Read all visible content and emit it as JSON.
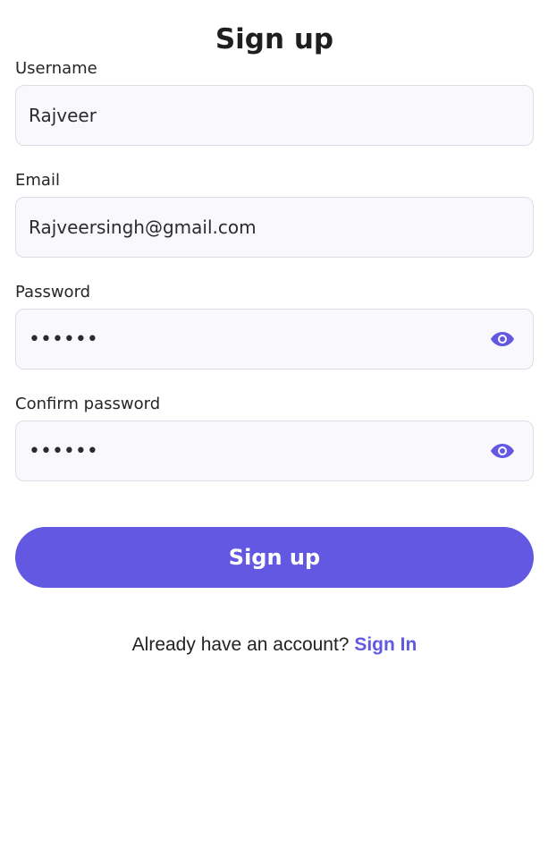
{
  "screen": {
    "title": "Sign up"
  },
  "form": {
    "username": {
      "label": "Username",
      "value": "Rajveer"
    },
    "email": {
      "label": "Email",
      "value": "Rajveersingh@gmail.com"
    },
    "password": {
      "label": "Password",
      "value": "••••••",
      "icon": "eye-icon"
    },
    "confirm_password": {
      "label": "Confirm password",
      "value": "••••••",
      "icon": "eye-icon"
    },
    "submit_label": "Sign up"
  },
  "footer": {
    "prompt": "Already have an account?",
    "link_label": "Sign In"
  },
  "colors": {
    "accent": "#6258e2",
    "field_background": "#f9f9fd",
    "field_border": "#dcdce4"
  }
}
